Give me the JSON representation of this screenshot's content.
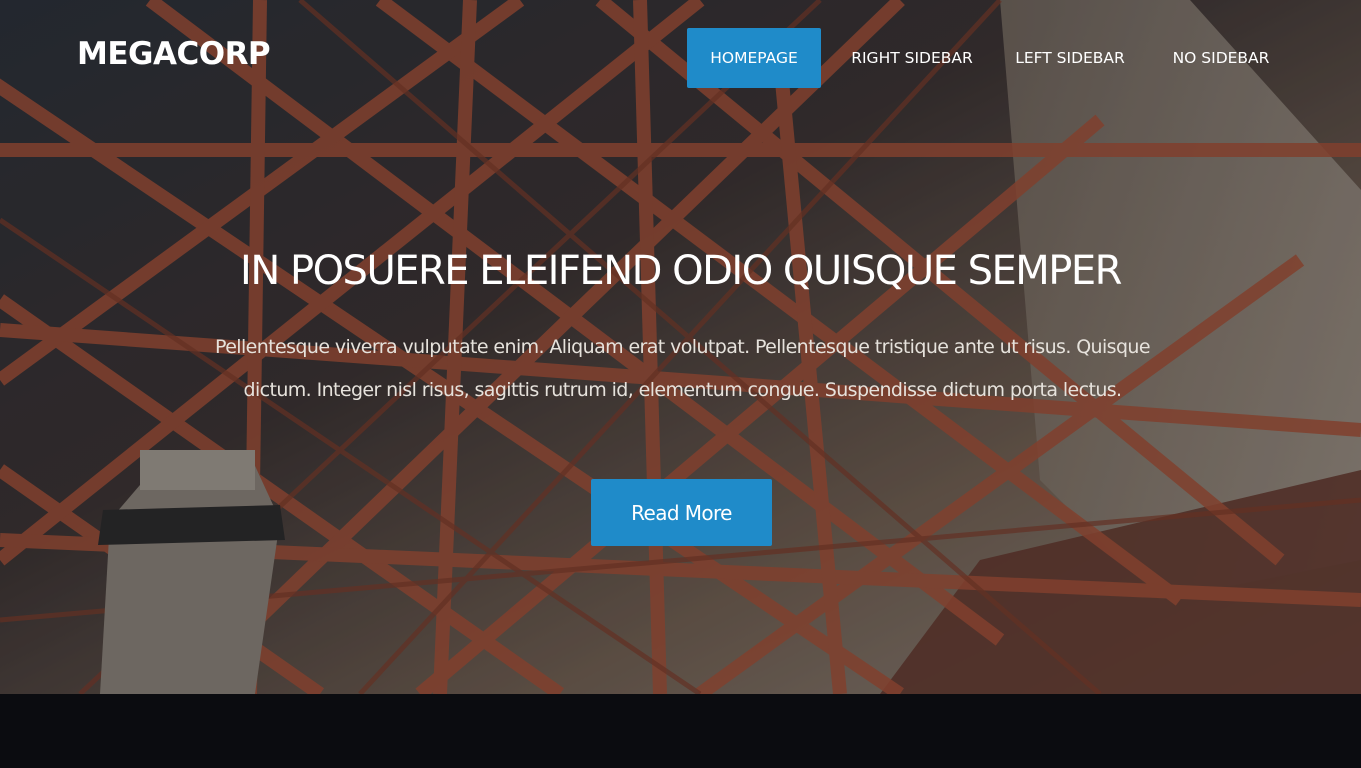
{
  "site": {
    "logo": "MEGACORP"
  },
  "nav": {
    "items": [
      {
        "label": "HOMEPAGE",
        "active": true
      },
      {
        "label": "RIGHT SIDEBAR",
        "active": false
      },
      {
        "label": "LEFT SIDEBAR",
        "active": false
      },
      {
        "label": "NO SIDEBAR",
        "active": false
      }
    ]
  },
  "hero": {
    "headline": "IN POSUERE ELEIFEND ODIO QUISQUE SEMPER",
    "lead": "Pellentesque viverra vulputate enim. Aliquam erat volutpat. Pellentesque tristique ante ut risus. Quisque dictum. Integer nisl risus, sagittis rutrum id, elementum congue. Suspendisse dictum porta lectus.",
    "cta_label": "Read More"
  },
  "colors": {
    "accent": "#1f8bc9",
    "footer": "#0b0c10",
    "beam": "#b8573a"
  }
}
